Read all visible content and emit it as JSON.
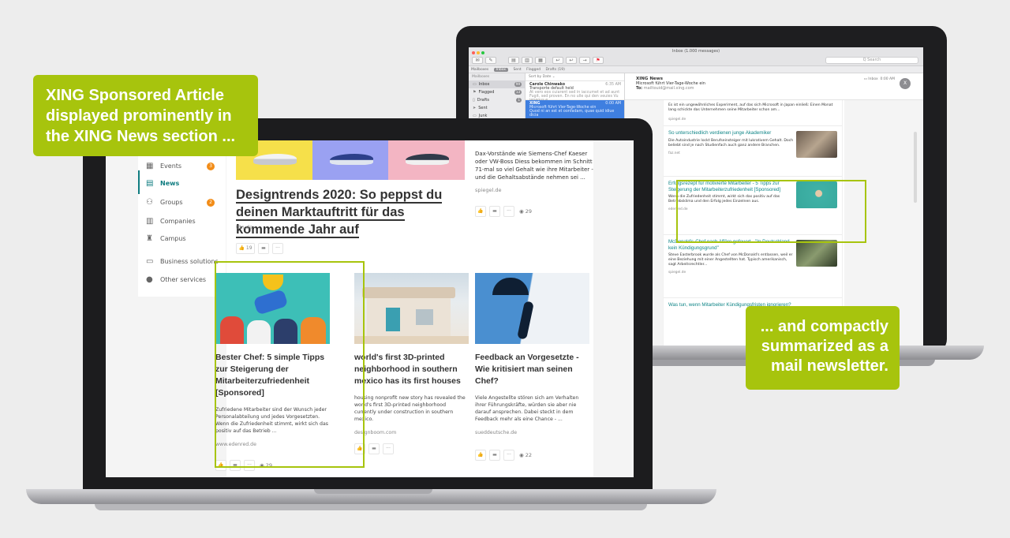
{
  "callouts": {
    "left": "XING Sponsored Article displayed prominently in the XING News section ...",
    "right": "... and compactly summarized as a mail newsletter."
  },
  "colors": {
    "xing_green": "#a7c40d",
    "xing_teal": "#0f7c80",
    "badge_orange": "#f28c17",
    "mail_select": "#3f7fe0"
  },
  "mail": {
    "window_title": "Inbox (1.000 messages)",
    "search_placeholder": "Q Search",
    "tabs": [
      "Mailboxes",
      "Inbox",
      "Sent",
      "Flagged",
      "Drafts (19)"
    ],
    "sidebar_header": "Mailboxes",
    "sidebar": [
      {
        "icon": "inbox-icon",
        "glyph": "▭",
        "label": "Inbox",
        "count": "99"
      },
      {
        "icon": "flag-icon",
        "glyph": "⚑",
        "label": "Flagged",
        "count": "13"
      },
      {
        "icon": "drafts-icon",
        "glyph": "▯",
        "label": "Drafts",
        "count": "1"
      },
      {
        "icon": "sent-icon",
        "glyph": "➤",
        "label": "Sent",
        "count": ""
      },
      {
        "icon": "junk-icon",
        "glyph": "▭",
        "label": "Junk",
        "count": ""
      }
    ],
    "sort_label": "Sort by Date ⌄",
    "messages": [
      {
        "from": "Carole Chinwako",
        "time": "6:35 AM",
        "subject": "Transporte default held",
        "preview": "At vero eos cuiarent sed in iaccumet et ad aunt Fugit, sed proven. En no ulle qui den veuies Vu ieneous e."
      },
      {
        "from": "XING",
        "time": "0:00 AM",
        "subject": "Microsoft führt Vier-Tage-Woche ein",
        "preview": "Quod ni an est et oonfadam, quae quid idiue dicia"
      }
    ],
    "header": {
      "from": "XING News",
      "subject": "Microsoft führt Vier-Tage-Woche ein",
      "to_label": "To:",
      "to_value": "mailtouid@mail.xing.com",
      "mailbox": "Inbox",
      "time": "0:00 AM",
      "avatar": "X"
    },
    "newsletter": {
      "top_text": "Es ist ein ungewöhnliches Experiment, auf das sich Microsoft in Japan einließ: Einen Monat lang schickte das Unternehmen seine Mitarbeiter schon am...",
      "top_source": "spiegel.de",
      "items": [
        {
          "title": "So unterschiedlich verdienen junge Akademiker",
          "desc": "Die Autoindustrie lockt Berufseinsteiger mit lukrativem Gehalt. Doch beliebt sind je nach Studienfach auch ganz andere Branchen.",
          "source": "faz.net"
        },
        {
          "title": "Erfolgsrezept für motivierte Mitarbeiter - 5 Tipps zur Steigerung der Mitarbeiterzufriedenheit [Sponsored]",
          "desc": "Wenn die Zufriedenheit stimmt, wirkt sich das positiv auf das Betriebsklima und den Erfolg jedes Einzelnen aus.",
          "source": "edenred.de"
        },
        {
          "title": "McDonald's-Chef nach Affäre gefeuert - \"In Deutschland kein Kündigungsgrund\"",
          "desc": "Steve Easterbrook wurde als Chef von McDonald's entlassen, weil er eine Beziehung mit einer Angestellten hat. Typisch amerikanisch, sagt Arbeitsrechtler...",
          "source": "spiegel.de"
        },
        {
          "title": "Was tun, wenn Mitarbeiter Kündigungsfristen ignorieren?",
          "desc": "",
          "source": ""
        }
      ]
    }
  },
  "xing": {
    "nav": [
      {
        "icon": "calendar-icon",
        "glyph": "▦",
        "label": "Events",
        "badge": "3"
      },
      {
        "icon": "news-icon",
        "glyph": "▤",
        "label": "News",
        "badge": ""
      },
      {
        "icon": "groups-icon",
        "glyph": "⚇",
        "label": "Groups",
        "badge": "2"
      },
      {
        "icon": "companies-icon",
        "glyph": "▥",
        "label": "Companies",
        "badge": ""
      },
      {
        "icon": "campus-icon",
        "glyph": "♜",
        "label": "Campus",
        "badge": ""
      },
      {
        "icon": "business-icon",
        "glyph": "▭",
        "label": "Business solutions",
        "badge": ""
      },
      {
        "icon": "more-icon",
        "glyph": "●",
        "label": "Other services",
        "badge": ""
      }
    ],
    "main": {
      "title": "Designtrends 2020: So peppst du deinen Marktauftritt für das kommende Jahr auf",
      "source": "t3n.de",
      "likes": "19"
    },
    "side": {
      "text": "Dax-Vorstände wie Siemens-Chef Kaeser oder VW-Boss Diess bekommen im Schnitt 71-mal so viel Gehalt wie ihre Mitarbeiter - und die Gehaltsabstände nehmen sei ...",
      "source": "spiegel.de",
      "views": "29"
    },
    "cards": [
      {
        "title": "Bester Chef: 5 simple Tipps zur Steigerung der Mitarbeiterzufriedenheit [Sponsored]",
        "desc": "Zufriedene Mitarbeiter sind der Wunsch jeder Personalabteilung und jedes Vorgesetzten. Wenn die Zufriedenheit stimmt, wirkt sich das positiv auf das Betrieb ...",
        "source": "www.edenred.de",
        "views": "29"
      },
      {
        "title": "world's first 3D-printed neighborhood in southern mexico has its first houses",
        "desc": "housing nonprofit new story has revealed the world's first 3D-printed neighborhood currently under construction in southern mexico.",
        "source": "designboom.com",
        "views": ""
      },
      {
        "title": "Feedback an Vorgesetzte - Wie kritisiert man seinen Chef?",
        "desc": "Viele Angestellte stören sich am Verhalten ihrer Führungskräfte, würden sie aber nie darauf ansprechen. Dabei steckt in dem Feedback mehr als eine Chance - ...",
        "source": "sueddeutsche.de",
        "views": "22"
      }
    ]
  }
}
